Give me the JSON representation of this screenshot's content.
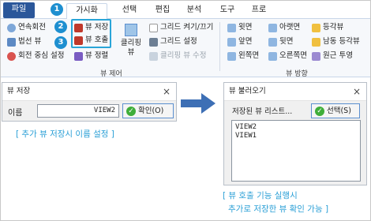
{
  "ribbon": {
    "tabs": [
      "파일",
      "가시화",
      "선택",
      "편집",
      "분석",
      "도구",
      "프로"
    ],
    "badges": [
      "1",
      "2",
      "3"
    ],
    "group1": {
      "items": [
        "연속회전",
        "법선 뷰",
        "회전 중심 설정"
      ]
    },
    "view_group": {
      "save": "뷰 저장",
      "recall": "뷰 호출",
      "align": "뷰 정렬",
      "clipping": "클리핑 뷰",
      "grid_toggle": "그리드 켜기/끄기",
      "grid_settings": "그리드 설정",
      "clipping_edit": "클리핑 뷰 수정",
      "label": "뷰 제어"
    },
    "direction_group": {
      "col1": [
        "윗면",
        "앞면",
        "왼쪽면"
      ],
      "col2": [
        "아랫면",
        "뒷면",
        "오른쪽면"
      ],
      "col3": [
        "등각뷰",
        "남동 등각뷰",
        "원근 투영"
      ],
      "label": "뷰 방향"
    }
  },
  "save_dialog": {
    "title": "뷰 저장",
    "close": "×",
    "name_label": "이름",
    "name_value": "VIEW2",
    "ok_label": "확인(O)"
  },
  "load_dialog": {
    "title": "뷰 불러오기",
    "close": "×",
    "list_label": "저장된 뷰 리스트...",
    "select_label": "선택(S)",
    "items": [
      "VIEW2",
      "VIEW1"
    ]
  },
  "captions": {
    "left": "[ 추가 뷰 저장시 이름 설정 ]",
    "right_line1": "[ 뷰 호출 기능 실행시",
    "right_line2": "추가로 저장한 뷰 확인 가능 ]"
  },
  "colors": {
    "accent": "#2a9fd6",
    "badge": "#1e8fd0",
    "file_tab": "#2b579a",
    "arrow": "#3d6fb5",
    "ok_check": "#3fae3a"
  }
}
